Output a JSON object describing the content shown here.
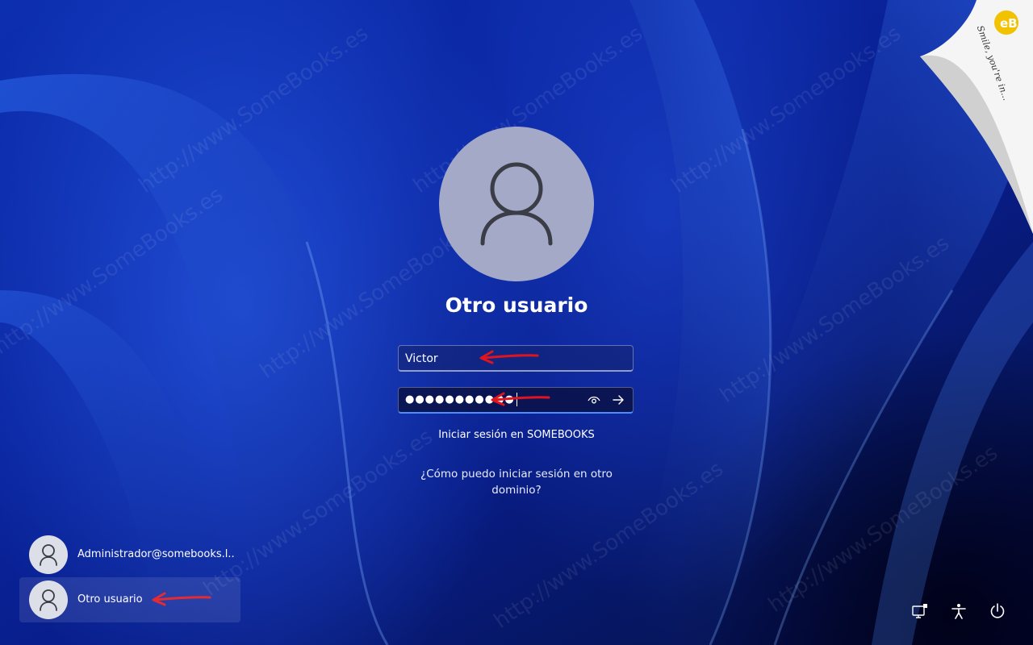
{
  "login": {
    "title": "Otro usuario",
    "username_value": "Victor",
    "password_value": "●●●●●●●●●●●",
    "domain_label": "Iniciar sesión en SOMEBOOKS",
    "help_link": "¿Cómo puedo iniciar sesión en otro dominio?"
  },
  "users": [
    {
      "name": "Administrador@somebooks.l..."
    },
    {
      "name": "Otro usuario"
    }
  ],
  "icons": {
    "avatar": "user-icon",
    "reveal": "eye-icon",
    "submit": "arrow-right-icon",
    "network": "network-icon",
    "accessibility": "accessibility-icon",
    "power": "power-icon"
  },
  "watermark": "http://www.SomeBooks.es",
  "brand": {
    "name": "SomeBooks",
    "tagline": "Smile, you're in..."
  },
  "colors": {
    "accent": "#4c8dff",
    "annotation_arrow": "#e0141e",
    "avatar_bg": "#a3a9c6"
  }
}
